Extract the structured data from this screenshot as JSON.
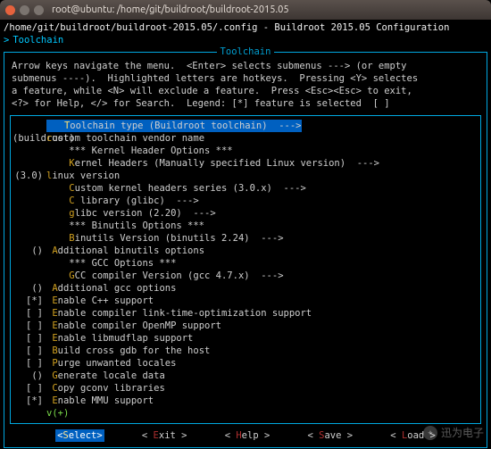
{
  "titlebar": {
    "title": "root@ubuntu: /home/git/buildroot/buildroot-2015.05"
  },
  "pathline": "/home/git/buildroot/buildroot-2015.05/.config - Buildroot 2015.05 Configuration",
  "breadcrumb": {
    "arrow": ">",
    "text": "Toolchain"
  },
  "dialog": {
    "title": "Toolchain",
    "help": "Arrow keys navigate the menu.  <Enter> selects submenus ---> (or empty\nsubmenus ----).  Highlighted letters are hotkeys.  Pressing <Y> selectes\na feature, while <N> will exclude a feature.  Press <Esc><Esc> to exit,\n<?> for Help, </> for Search.  Legend: [*] feature is selected  [ ]"
  },
  "items": [
    {
      "mark": "",
      "pre": "   ",
      "hk": "T",
      "post": "oolchain type (Buildroot toolchain)  --->",
      "selected": true
    },
    {
      "mark": "(buildroot)",
      "pre": "",
      "hk": "c",
      "post": "ustom toolchain vendor name"
    },
    {
      "mark": "",
      "pre": "    *** ",
      "hk": "",
      "post": "Kernel Header Options ***"
    },
    {
      "mark": "",
      "pre": "    ",
      "hk": "K",
      "post": "ernel Headers (Manually specified Linux version)  --->"
    },
    {
      "mark": "(3.0)",
      "pre": "",
      "hk": "l",
      "post": "inux version"
    },
    {
      "mark": "",
      "pre": "    ",
      "hk": "C",
      "post": "ustom kernel headers series (3.0.x)  --->"
    },
    {
      "mark": "",
      "pre": "    ",
      "hk": "C",
      "post": " library (glibc)  --->"
    },
    {
      "mark": "",
      "pre": "    ",
      "hk": "g",
      "post": "libc version (2.20)  --->"
    },
    {
      "mark": "",
      "pre": "    *** ",
      "hk": "",
      "post": "Binutils Options ***"
    },
    {
      "mark": "",
      "pre": "    ",
      "hk": "B",
      "post": "inutils Version (binutils 2.24)  --->"
    },
    {
      "mark": "()",
      "pre": " ",
      "hk": "A",
      "post": "dditional binutils options"
    },
    {
      "mark": "",
      "pre": "    *** ",
      "hk": "",
      "post": "GCC Options ***"
    },
    {
      "mark": "",
      "pre": "    ",
      "hk": "G",
      "post": "CC compiler Version (gcc 4.7.x)  --->"
    },
    {
      "mark": "()",
      "pre": " ",
      "hk": "A",
      "post": "dditional gcc options"
    },
    {
      "mark": "[*]",
      "pre": " ",
      "hk": "E",
      "post": "nable C++ support"
    },
    {
      "mark": "[ ]",
      "pre": " ",
      "hk": "E",
      "post": "nable compiler link-time-optimization support"
    },
    {
      "mark": "[ ]",
      "pre": " ",
      "hk": "E",
      "post": "nable compiler OpenMP support"
    },
    {
      "mark": "[ ]",
      "pre": " ",
      "hk": "E",
      "post": "nable libmudflap support"
    },
    {
      "mark": "[ ]",
      "pre": " ",
      "hk": "B",
      "post": "uild cross gdb for the host"
    },
    {
      "mark": "[ ]",
      "pre": " ",
      "hk": "P",
      "post": "urge unwanted locales"
    },
    {
      "mark": "()",
      "pre": " ",
      "hk": "G",
      "post": "enerate locale data"
    },
    {
      "mark": "[ ]",
      "pre": " ",
      "hk": "C",
      "post": "opy gconv libraries"
    },
    {
      "mark": "[*]",
      "pre": " ",
      "hk": "E",
      "post": "nable MMU support"
    }
  ],
  "more": "v(+)",
  "buttons": [
    {
      "label": "Select",
      "hk": "S",
      "active": true
    },
    {
      "label": "Exit",
      "hk": "E",
      "active": false
    },
    {
      "label": "Help",
      "hk": "H",
      "active": false
    },
    {
      "label": "Save",
      "hk": "S",
      "active": false
    },
    {
      "label": "Load",
      "hk": "L",
      "active": false
    }
  ],
  "watermark": "迅为电子"
}
